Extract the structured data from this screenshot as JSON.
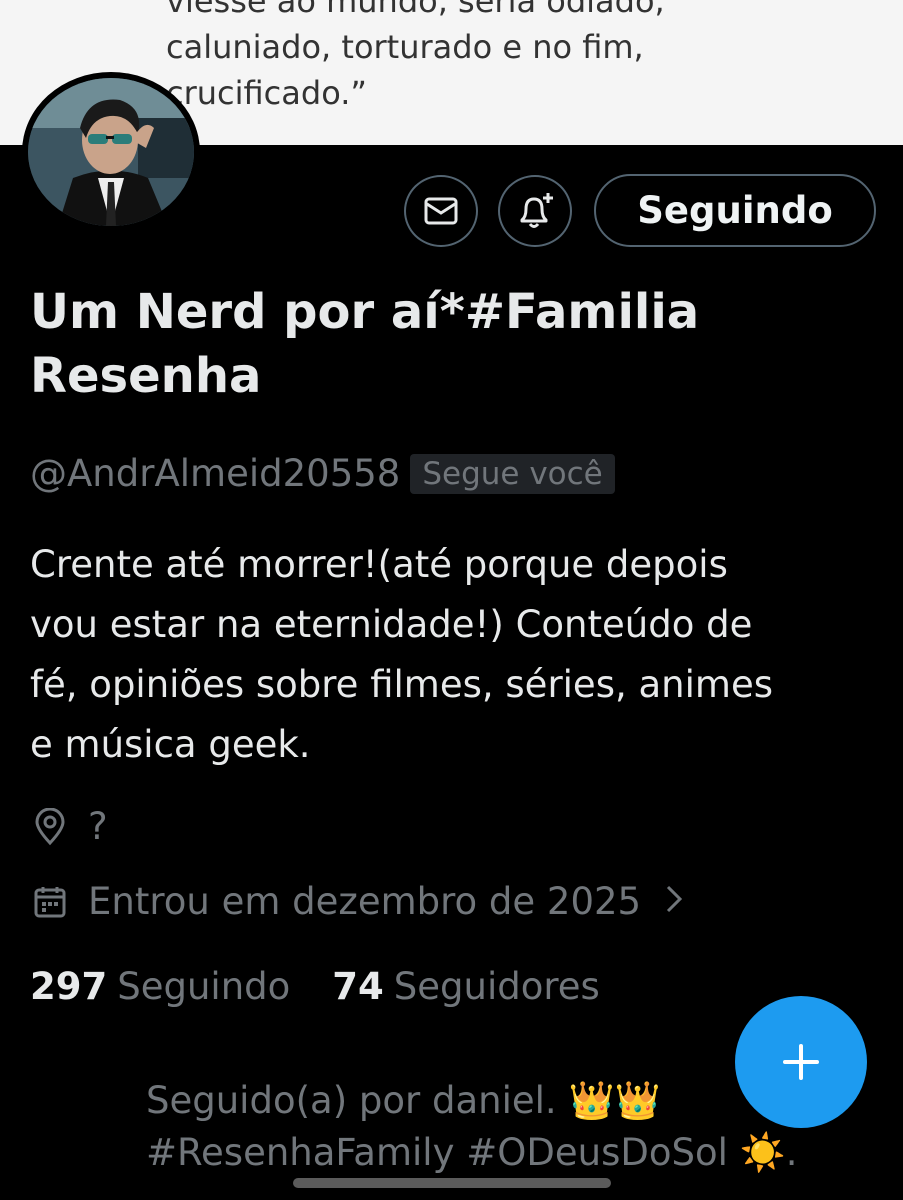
{
  "pinned_post": {
    "lines": [
      "viesse ao mundo, seria odiado,",
      "caluniado, torturado e no fim,",
      "crucificado.”"
    ]
  },
  "profile": {
    "display_name": "Um Nerd por aí*#Familia Resenha",
    "handle": "@AndrAlmeid20558",
    "follows_you_badge": "Segue você",
    "bio_lines": [
      "Crente até morrer!(até porque depois",
      "vou estar na eternidade!) Conteúdo de",
      "fé, opiniões sobre filmes, séries, animes",
      "e música geek."
    ],
    "location": "?",
    "joined": "Entrou em dezembro de 2025",
    "following_count": "297",
    "following_label": "Seguindo",
    "followers_count": "74",
    "followers_label": "Seguidores",
    "followed_by_lines": [
      "Seguido(a) por daniel. 👑👑",
      "#ResenhaFamily #ODeusDoSol ☀️."
    ]
  },
  "actions": {
    "message_icon": "envelope-icon",
    "notify_icon": "bell-plus-icon",
    "follow_label": "Seguindo"
  },
  "fab": {
    "icon": "plus-icon",
    "color": "#1d9bf0"
  },
  "colors": {
    "background": "#000000",
    "text_primary": "#e7e9ea",
    "text_secondary": "#71767b",
    "accent": "#1d9bf0",
    "border": "#536471"
  }
}
